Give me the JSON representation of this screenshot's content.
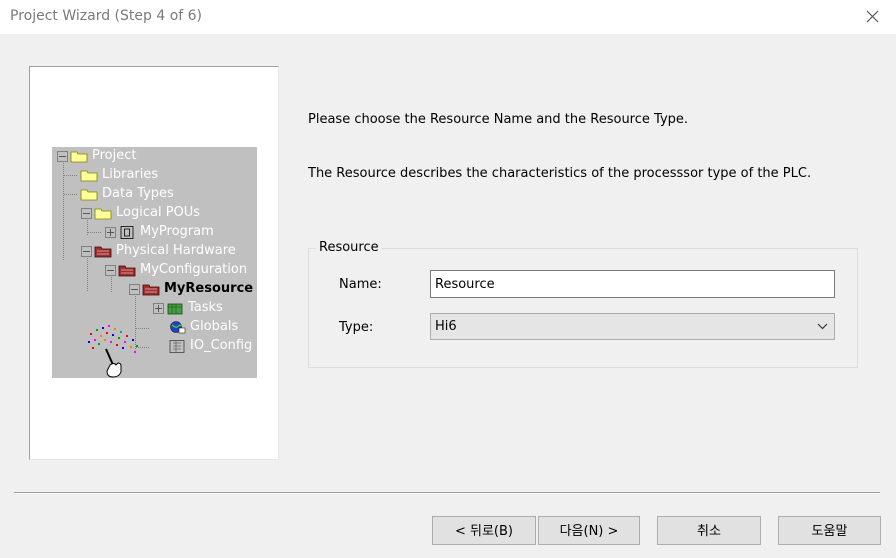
{
  "window": {
    "title": "Project Wizard (Step 4 of 6)",
    "close_icon": "close-icon"
  },
  "tree": {
    "items": [
      {
        "label": "Project",
        "icon": "folder-open-icon",
        "expander": "minus"
      },
      {
        "label": "Libraries",
        "icon": "folder-icon",
        "expander": ""
      },
      {
        "label": "Data Types",
        "icon": "folder-icon",
        "expander": ""
      },
      {
        "label": "Logical POUs",
        "icon": "folder-open-icon",
        "expander": "minus"
      },
      {
        "label": "MyProgram",
        "icon": "program-icon",
        "expander": "plus"
      },
      {
        "label": "Physical Hardware",
        "icon": "hardware-folder-icon",
        "expander": "minus"
      },
      {
        "label": "MyConfiguration",
        "icon": "configuration-icon",
        "expander": "minus"
      },
      {
        "label": "MyResource",
        "icon": "resource-icon",
        "expander": "minus"
      },
      {
        "label": "Tasks",
        "icon": "tasks-icon",
        "expander": "plus"
      },
      {
        "label": "Globals",
        "icon": "globals-icon",
        "expander": ""
      },
      {
        "label": "IO_Config",
        "icon": "io-config-icon",
        "expander": ""
      }
    ]
  },
  "instructions": {
    "line1": "Please choose the Resource Name and the Resource Type.",
    "line2": "The Resource describes the characteristics of the processsor type of the PLC."
  },
  "resource": {
    "group_label": "Resource",
    "name_label": "Name:",
    "name_value": "Resource",
    "type_label": "Type:",
    "type_value": "Hi6"
  },
  "buttons": {
    "back": "< 뒤로(B)",
    "next": "다음(N) >",
    "cancel": "취소",
    "help": "도움말"
  },
  "colors": {
    "background": "#f0f0f0",
    "tree_bg": "#c0c0c0",
    "folder": "#ffff99",
    "hardware": "#a03030"
  }
}
